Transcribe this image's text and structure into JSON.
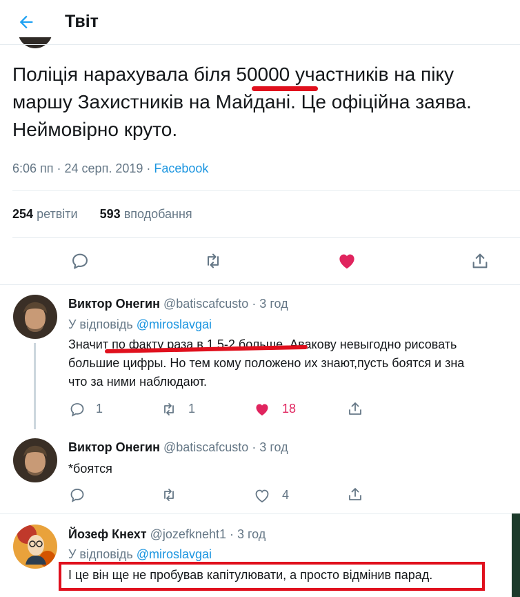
{
  "header": {
    "title": "Твіт",
    "back_icon": "arrow-left-icon",
    "accent": "#1da1f2"
  },
  "tweet": {
    "text": "Поліція нарахувала біля 50000 участників на піку\nмаршу Захистників на Майдані. Це офіційна заява.\nНеймовірно круто.",
    "time": "6:06 пп · 24 серп. 2019 · ",
    "source": "Facebook",
    "retweets_count": "254",
    "retweets_label": "ретвіти",
    "likes_count": "593",
    "likes_label": "вподобання"
  },
  "replies": [
    {
      "name": "Виктор Онегин",
      "handle": "@batiscafcusto · 3 год",
      "reply_to_prefix": "У відповідь ",
      "reply_to": "@miroslavgai",
      "lines": [
        "Значит по факту раза в 1.5-2 больше. Авакову невыгодно рисовать",
        "большие цифры. Но тем кому положено их знают,пусть боятся и зна",
        "что за ними наблюдают."
      ],
      "reply_count": "1",
      "retweet_count": "1",
      "like_count": "18",
      "liked": true
    },
    {
      "name": "Виктор Онегин",
      "handle": "@batiscafcusto · 3 год",
      "lines": [
        "*боятся"
      ],
      "like_count": "4",
      "liked": false
    },
    {
      "name": "Йозеф Кнехт",
      "handle": "@jozefkneht1 · 3 год",
      "reply_to_prefix": "У відповідь ",
      "reply_to": "@miroslavgai",
      "lines": [
        "І це він ще не пробував капітулювати, а просто відмінив парад."
      ]
    }
  ],
  "colors": {
    "like": "#e0245e",
    "highlight": "#e0101d",
    "muted": "#657786"
  }
}
